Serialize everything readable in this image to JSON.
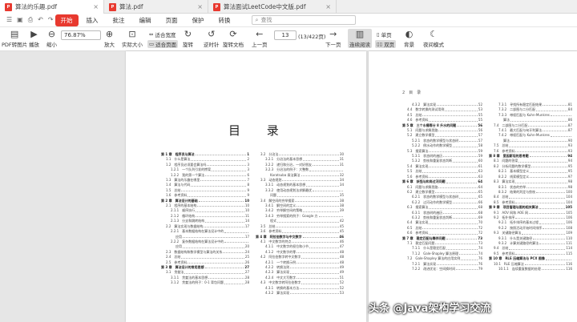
{
  "tabs": [
    {
      "label": "算法的乐趣.pdf"
    },
    {
      "label": "算法.pdf"
    },
    {
      "label": "算法面试LeetCode中文版.pdf"
    }
  ],
  "menu": [
    "开始",
    "插入",
    "批注",
    "编辑",
    "页面",
    "保护",
    "转换"
  ],
  "search": {
    "placeholder": "查找"
  },
  "toolbar": {
    "pdf_to_image": "PDF转图片",
    "play": "播放",
    "zoom_out": "缩小",
    "zoom_value": "76.87%",
    "zoom_in": "放大",
    "actual_size": "实际大小",
    "fit_width": "适合宽度",
    "fit_page": "适合页面",
    "rotate_left": "旋转",
    "rotate_ccw": "逆时针",
    "rotate_doc": "旋转文档",
    "prev": "上一页",
    "page": "13",
    "page_count": "(13/422页)",
    "next": "下一页",
    "continuous": "连续阅读",
    "single": "单页",
    "double": "双页",
    "background": "背景",
    "night": "夜间模式"
  },
  "left_page": {
    "title": "目 录",
    "col1": [
      {
        "t": "第 1 章　程序员与算法",
        "p": "1",
        "c": 1
      },
      {
        "t": "1.1　什么是算法",
        "p": "2",
        "i": 1
      },
      {
        "t": "1.2　程序员必须要会算法吗",
        "p": "3",
        "i": 1
      },
      {
        "t": "1.2.1　一个队列引发的惨案",
        "p": "3",
        "i": 2
      },
      {
        "t": "1.2.2　我的第一个算法",
        "p": "6",
        "i": 2
      },
      {
        "t": "1.3　算法的乐趣在哪里",
        "p": "7",
        "i": 1
      },
      {
        "t": "1.4　算法与代码",
        "p": "8",
        "i": 1
      },
      {
        "t": "1.5　总结",
        "p": "9",
        "i": 1
      },
      {
        "t": "1.6　参考资料",
        "p": "9",
        "i": 1
      },
      {
        "t": "第 2 章　算法设计的基础",
        "p": "10",
        "c": 1
      },
      {
        "t": "2.1　程序的基本结构",
        "p": "10",
        "i": 1
      },
      {
        "t": "2.1.1　顺序执行",
        "p": "10",
        "i": 2
      },
      {
        "t": "2.1.2　循环结构",
        "p": "11",
        "i": 2
      },
      {
        "t": "2.1.3　分支和跳转结构",
        "p": "14",
        "i": 2
      },
      {
        "t": "2.2　算法实现与数据结构",
        "p": "17",
        "i": 1
      },
      {
        "t": "2.2.1　基本数据结构在算法设计中的",
        "p": "",
        "i": 2
      },
      {
        "t": "应用",
        "p": "17",
        "i": 3
      },
      {
        "t": "2.2.2　复杂数据结构在算法设计中的",
        "p": "",
        "i": 2
      },
      {
        "t": "应用",
        "p": "20",
        "i": 3
      },
      {
        "t": "2.3　数据结构和数学模型与算法的关系",
        "p": "24",
        "i": 1
      },
      {
        "t": "2.4　总结",
        "p": "25",
        "i": 1
      },
      {
        "t": "2.5　参考资料",
        "p": "26",
        "i": 1
      },
      {
        "t": "第 3 章　算法设计的常用思想",
        "p": "27",
        "c": 1
      },
      {
        "t": "3.1　贪婪法",
        "p": "27",
        "i": 1
      },
      {
        "t": "3.1.1　贪婪法的基本思想",
        "p": "28",
        "i": 2
      },
      {
        "t": "3.1.2　贪婪法的例子：0-1 背包问题",
        "p": "28",
        "i": 2
      }
    ],
    "col2": [
      {
        "t": "3.2　分治法",
        "p": "30",
        "i": 1
      },
      {
        "t": "3.2.1　分治法的基本思想",
        "p": "31",
        "i": 2
      },
      {
        "t": "3.2.2　递归和分治，一对好朋友",
        "p": "31",
        "i": 2
      },
      {
        "t": "3.2.3　分治法的例子：大整数",
        "p": "",
        "i": 2
      },
      {
        "t": "Karatsuba 乘法算法",
        "p": "32",
        "i": 3
      },
      {
        "t": "3.3　动态规划",
        "p": "34",
        "i": 1
      },
      {
        "t": "3.3.1　动态规划的基本思想",
        "p": "34",
        "i": 2
      },
      {
        "t": "3.3.2　使用动态规划法求解最优",
        "p": "",
        "i": 2
      },
      {
        "t": "问题",
        "p": "35",
        "i": 3
      },
      {
        "t": "3.4　解空间的穷举搜索",
        "p": "38",
        "i": 1
      },
      {
        "t": "3.4.1　解空间的定义",
        "p": "38",
        "i": 2
      },
      {
        "t": "3.4.2　穷举解空间的策略",
        "p": "39",
        "i": 2
      },
      {
        "t": "3.4.3　穷举搜索的例子：Google 方",
        "p": "",
        "i": 2
      },
      {
        "t": "程式",
        "p": "42",
        "i": 3
      },
      {
        "t": "3.5　总结",
        "p": "45",
        "i": 1
      },
      {
        "t": "3.6　参考资料",
        "p": "45",
        "i": 1
      },
      {
        "t": "第 4 章　阿拉伯数字与中文数字",
        "p": "46",
        "c": 1
      },
      {
        "t": "4.1　中文数字的特点",
        "p": "46",
        "i": 1
      },
      {
        "t": "4.1.1　中文数字的权位和小节",
        "p": "47",
        "i": 2
      },
      {
        "t": "4.1.2　中文数字的零",
        "p": "48",
        "i": 2
      },
      {
        "t": "4.2　阿拉伯数字转中文数字",
        "p": "48",
        "i": 1
      },
      {
        "t": "4.2.1　一个转换示例",
        "p": "48",
        "i": 2
      },
      {
        "t": "4.2.2　转换法则",
        "p": "49",
        "i": 2
      },
      {
        "t": "4.2.3　算法实现",
        "p": "49",
        "i": 2
      },
      {
        "t": "4.2.4　中文大写数字",
        "p": "51",
        "i": 2
      },
      {
        "t": "4.3　中文数字转阿拉伯数字",
        "p": "52",
        "i": 1
      },
      {
        "t": "4.3.1　转换的基本方法",
        "p": "52",
        "i": 2
      },
      {
        "t": "4.3.2　算法实现",
        "p": "53",
        "i": 2
      }
    ]
  },
  "right_page": {
    "header": "2　目　录",
    "col1": [
      {
        "t": "4.3.2　算法实现",
        "p": "52",
        "i": 2
      },
      {
        "t": "4.4　数字转换的测试用例",
        "p": "53",
        "i": 1
      },
      {
        "t": "4.5　总结",
        "p": "55",
        "i": 1
      },
      {
        "t": "4.6　参考资料",
        "p": "55",
        "i": 1
      },
      {
        "t": "第 5 章　三个水桶等分 8 升水的问题",
        "p": "56",
        "c": 1
      },
      {
        "t": "5.1　问题与求解思路",
        "p": "56",
        "i": 1
      },
      {
        "t": "5.2　建立数学模型",
        "p": "57",
        "i": 1
      },
      {
        "t": "5.2.1　状态的数学模型与状态树",
        "p": "57",
        "i": 2
      },
      {
        "t": "5.2.2　倒水动作的数学模型",
        "p": "58",
        "i": 2
      },
      {
        "t": "5.3　搜索算法",
        "p": "59",
        "i": 1
      },
      {
        "t": "5.3.1　状态树的遍历",
        "p": "59",
        "i": 2
      },
      {
        "t": "5.3.2　剪枝和重复状态判断",
        "p": "60",
        "i": 2
      },
      {
        "t": "5.4　算法实现",
        "p": "61",
        "i": 1
      },
      {
        "t": "5.5　总结",
        "p": "63",
        "i": 1
      },
      {
        "t": "5.6　参考资料",
        "p": "63",
        "i": 1
      },
      {
        "t": "第 6 章　妖怪与和尚过河问题",
        "p": "64",
        "c": 1
      },
      {
        "t": "6.1　问题与求解思路",
        "p": "64",
        "i": 1
      },
      {
        "t": "6.2　建立数学模型",
        "p": "65",
        "i": 1
      },
      {
        "t": "6.2.1　状态的数学模型与状态树",
        "p": "65",
        "i": 2
      },
      {
        "t": "6.2.2　过河动作的数学模型",
        "p": "66",
        "i": 2
      },
      {
        "t": "6.3　搜索算法",
        "p": "68",
        "i": 1
      },
      {
        "t": "6.3.1　状态树的遍历",
        "p": "68",
        "i": 2
      },
      {
        "t": "6.3.2　剪枝和重复状态判断",
        "p": "69",
        "i": 2
      },
      {
        "t": "6.4　算法实现",
        "p": "70",
        "i": 1
      },
      {
        "t": "6.5　总结",
        "p": "72",
        "i": 1
      },
      {
        "t": "6.6　参考资料",
        "p": "72",
        "i": 1
      },
      {
        "t": "第 7 章　稳定匹配与舞伴问题",
        "p": "73",
        "c": 1
      },
      {
        "t": "7.1　稳定匹配问题",
        "p": "73",
        "i": 1
      },
      {
        "t": "7.1.1　什么是稳定匹配",
        "p": "74",
        "i": 2
      },
      {
        "t": "7.1.2　Gale-Shapley 算法原理",
        "p": "74",
        "i": 2
      },
      {
        "t": "7.2　Gale-Shapley 算法的应用实例",
        "p": "76",
        "i": 1
      },
      {
        "t": "7.2.1　算法实现",
        "p": "76",
        "i": 2
      },
      {
        "t": "7.2.2　改进优化：空间换时间",
        "p": "79",
        "i": 2
      }
    ],
    "col2": [
      {
        "t": "7.3.1　寻找所有稳定匹配结果",
        "p": "81",
        "i": 2
      },
      {
        "t": "7.3.2　二部图与二分匹配",
        "p": "84",
        "i": 2
      },
      {
        "t": "7.3.3　带权匹配与 Kuhn-Munkres",
        "p": "",
        "i": 2
      },
      {
        "t": "算法",
        "p": "86",
        "i": 3
      },
      {
        "t": "7.4　二部图与二分匹配",
        "p": "87",
        "i": 1
      },
      {
        "t": "7.4.1　最大匹配与匈牙利算法",
        "p": "87",
        "i": 2
      },
      {
        "t": "7.4.2　带权匹配与 Kuhn-Munkres",
        "p": "",
        "i": 2
      },
      {
        "t": "算法",
        "p": "90",
        "i": 3
      },
      {
        "t": "7.5　总结",
        "p": "93",
        "i": 1
      },
      {
        "t": "7.6　参考资料",
        "p": "93",
        "i": 1
      },
      {
        "t": "第 8 章　爱因斯坦的思考题",
        "p": "94",
        "c": 1
      },
      {
        "t": "8.1　问题的答案",
        "p": "94",
        "i": 1
      },
      {
        "t": "8.2　分析问题的数学模型",
        "p": "95",
        "i": 1
      },
      {
        "t": "8.2.1　基本模型定义",
        "p": "95",
        "i": 2
      },
      {
        "t": "8.2.2　线索模型定义",
        "p": "97",
        "i": 2
      },
      {
        "t": "8.3　算法实现",
        "p": "98",
        "i": 1
      },
      {
        "t": "8.3.1　状态的穷举",
        "p": "98",
        "i": 2
      },
      {
        "t": "8.3.2　结果的判定与剪枝",
        "p": "100",
        "i": 2
      },
      {
        "t": "8.4　总结",
        "p": "104",
        "i": 1
      },
      {
        "t": "8.5　参考资料",
        "p": "104",
        "i": 1
      },
      {
        "t": "第 9 章　项目管理与图的相关算法",
        "p": "105",
        "c": 1
      },
      {
        "t": "9.1　AOV 网和 AOE 网",
        "p": "105",
        "i": 1
      },
      {
        "t": "9.2　拓扑排序",
        "p": "106",
        "i": 1
      },
      {
        "t": "9.2.1　拓扑排序的基本过程",
        "p": "106",
        "i": 2
      },
      {
        "t": "9.2.2　按照活动开始时间排序",
        "p": "108",
        "i": 2
      },
      {
        "t": "9.3　关键路径算法",
        "p": "109",
        "i": 1
      },
      {
        "t": "9.3.1　什么是关键路径",
        "p": "110",
        "i": 2
      },
      {
        "t": "9.3.2　计算关键路径的算法",
        "p": "111",
        "i": 2
      },
      {
        "t": "9.4　总结",
        "p": "114",
        "i": 1
      },
      {
        "t": "9.5　参考资料",
        "p": "115",
        "i": 1
      },
      {
        "t": "第 10 章　RLE 压缩算法与 PCX 图像",
        "p": "",
        "c": 1
      },
      {
        "t": "10.1　RLE 压缩算法",
        "p": "116",
        "i": 1
      },
      {
        "t": "10.1.1　连续重复数据的处理",
        "p": "116",
        "i": 2
      }
    ]
  },
  "watermark": "头条 @Java架构学习交流"
}
